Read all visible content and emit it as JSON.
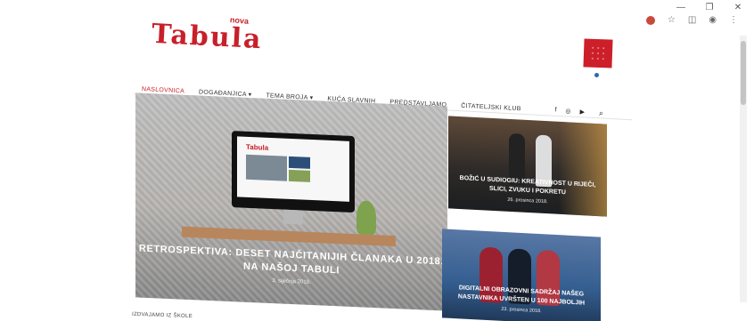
{
  "browser": {
    "controls": [
      "—",
      "❐",
      "✕"
    ],
    "icons": [
      "extension-icon",
      "star-icon",
      "camera-icon",
      "account-icon",
      "menu-icon"
    ]
  },
  "site": {
    "logo_main": "Tabula",
    "logo_sup": "nova"
  },
  "nav": {
    "items": [
      {
        "label": "NASLOVNICA",
        "active": true
      },
      {
        "label": "DOGAĐANJICA",
        "active": false
      },
      {
        "label": "TEMA BROJA",
        "active": false
      },
      {
        "label": "KUĆA SLAVNIH",
        "active": false
      },
      {
        "label": "PREDSTAVLJAMO",
        "active": false
      },
      {
        "label": "ČITATELJSKI KLUB",
        "active": false
      }
    ],
    "social": [
      "f",
      "◎",
      "▶"
    ],
    "search_icon": "search-icon"
  },
  "feature": {
    "title": "RETROSPEKTIVA: DESET NAJČITANIJIH ČLANAKA U 2018. NA NAŠOJ TABULI",
    "date": "3. siječnja 2019."
  },
  "cards": [
    {
      "title": "BOŽIĆ U SUDIOGIU: KREATIVNOST U RIJEČI, SLICI, ZVUKU I POKRETU",
      "date": "26. prosinca 2018."
    },
    {
      "title": "DIGITALNI OBRAZOVNI SADRŽAJ NAŠEG NASTAVNIKA UVRŠTEN U 100 NAJBOLJIH",
      "date": "23. prosinca 2018."
    }
  ],
  "bottom": {
    "label": "IZDVAJAMO IZ ŠKOLE"
  }
}
